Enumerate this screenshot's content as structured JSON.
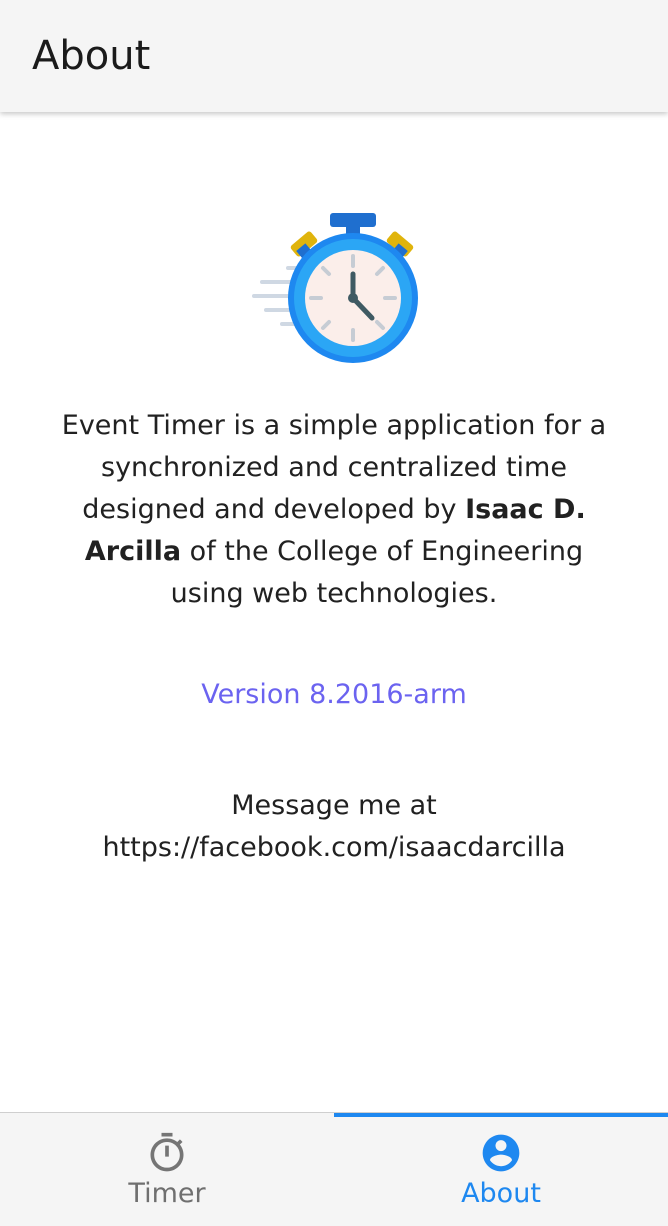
{
  "header": {
    "title": "About"
  },
  "illustration": {
    "icon": "stopwatch-icon"
  },
  "about": {
    "text_before": "Event Timer is a simple application for a synchronized and centralized time designed and developed by ",
    "author": "Isaac D. Arcilla",
    "text_after": " of the College of Engineering using web technologies."
  },
  "version": {
    "label": "Version 8.2016-arm"
  },
  "contact": {
    "line1": "Message me at",
    "line2": "https://facebook.com/isaacdarcilla"
  },
  "bottom_nav": {
    "tabs": [
      {
        "label": "Timer",
        "icon": "timer-icon",
        "active": false
      },
      {
        "label": "About",
        "icon": "account-circle-icon",
        "active": true
      }
    ]
  },
  "colors": {
    "accent": "#1e88f0",
    "version_link": "#6b63f0",
    "inactive": "#6f6f6f",
    "appbar": "#f5f5f5"
  }
}
